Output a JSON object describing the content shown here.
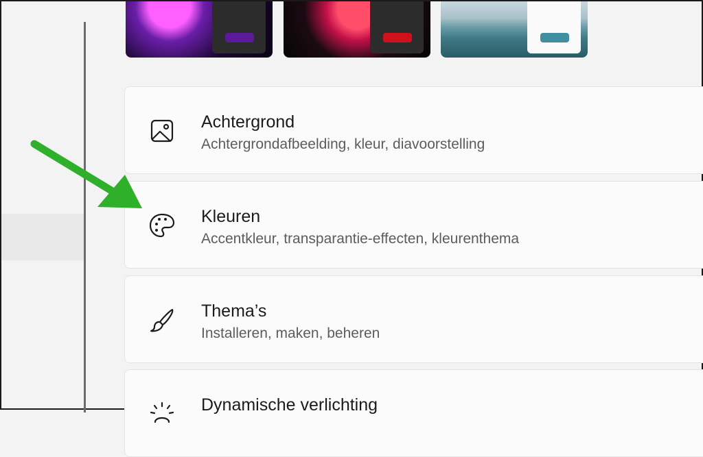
{
  "themes": [
    {
      "name": "theme-1",
      "accent": "#5a1a9a"
    },
    {
      "name": "theme-2",
      "accent": "#d0101a"
    },
    {
      "name": "theme-3",
      "accent": "#3f8fa1"
    }
  ],
  "cards": [
    {
      "title": "Achtergrond",
      "subtitle": "Achtergrondafbeelding, kleur, diavoorstelling",
      "icon": "image-icon"
    },
    {
      "title": "Kleuren",
      "subtitle": "Accentkleur, transparantie-effecten, kleurenthema",
      "icon": "palette-icon"
    },
    {
      "title": "Thema’s",
      "subtitle": "Installeren, maken, beheren",
      "icon": "brush-icon"
    },
    {
      "title": "Dynamische verlichting",
      "subtitle": "",
      "icon": "lighting-icon"
    }
  ],
  "colors": {
    "annotation_arrow": "#2eb02a"
  }
}
